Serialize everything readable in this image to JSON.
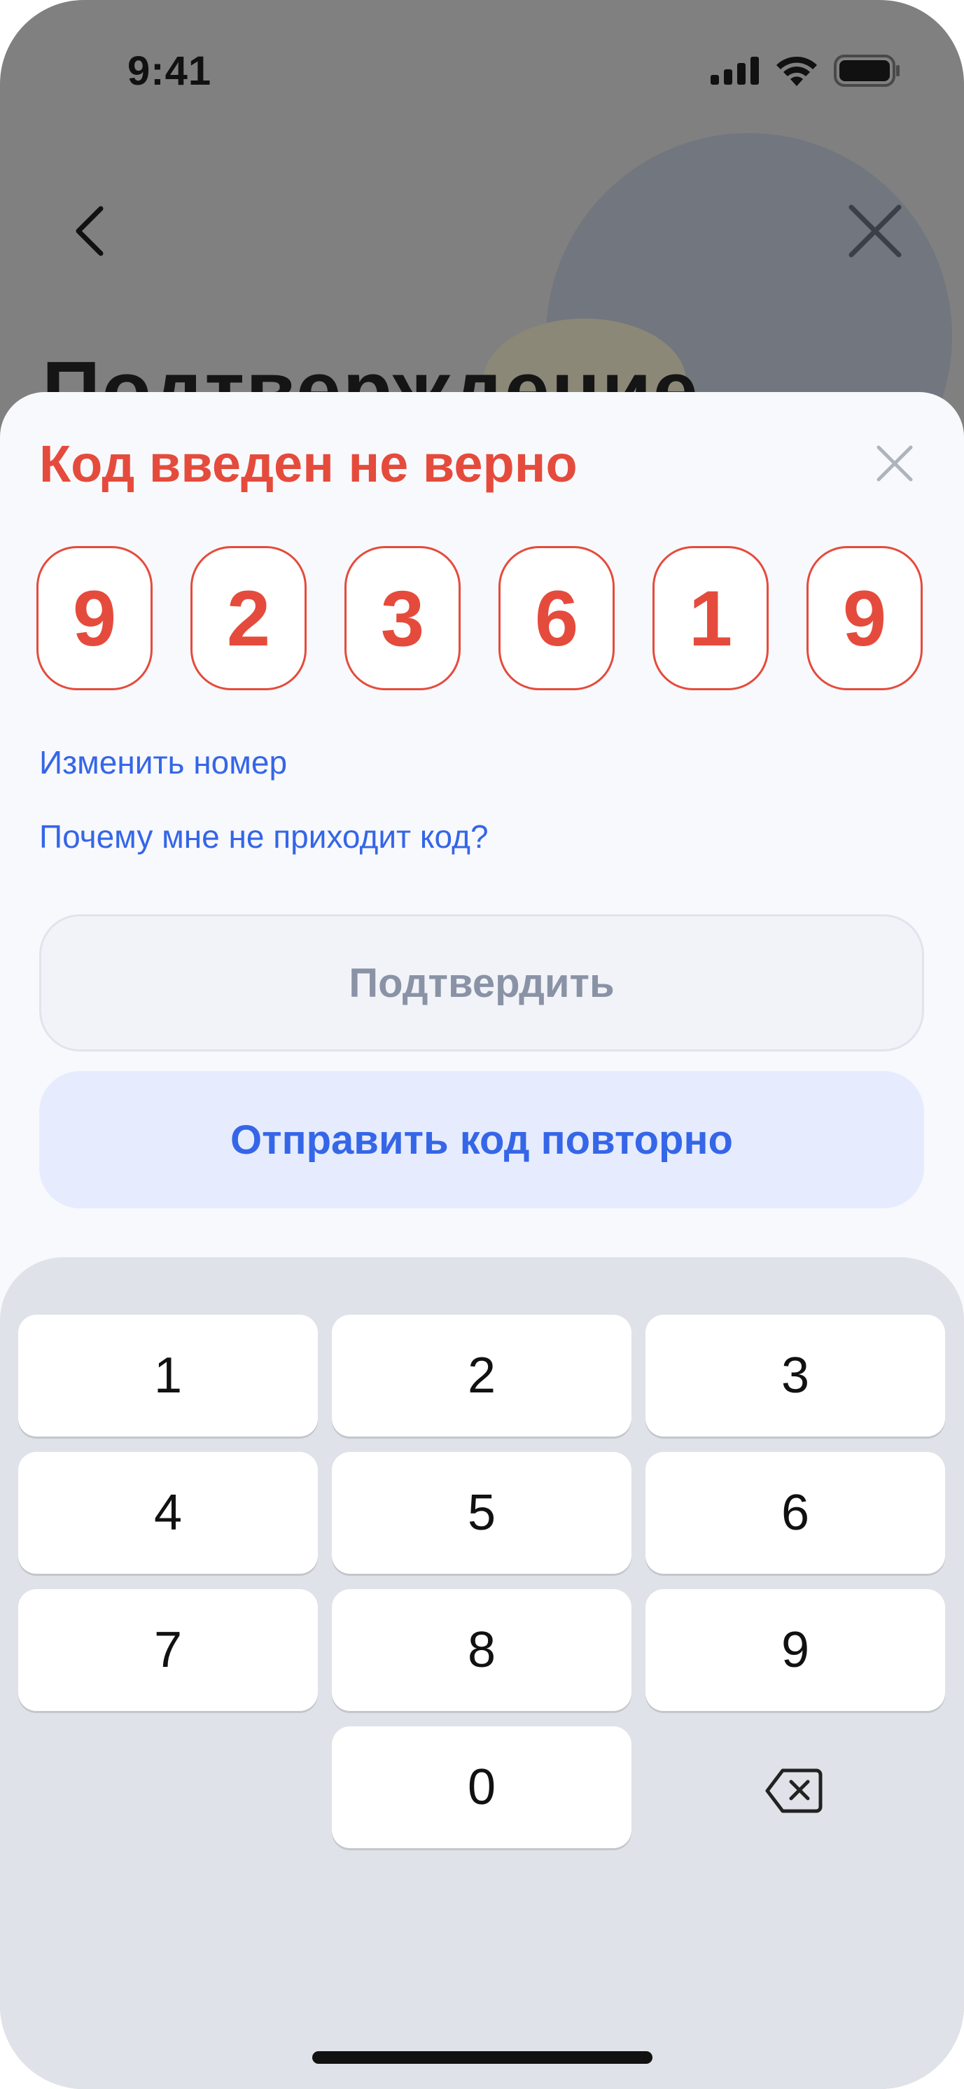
{
  "status": {
    "time": "9:41"
  },
  "background": {
    "title": "Подтверждение"
  },
  "sheet": {
    "title": "Код введен не верно",
    "code_digits": [
      "9",
      "2",
      "3",
      "6",
      "1",
      "9"
    ],
    "change_number_link": "Изменить номер",
    "why_no_code_link": "Почему мне не приходит код?",
    "confirm_button": "Подтвердить",
    "resend_button": "Отправить код повторно"
  },
  "keypad": {
    "keys": [
      "1",
      "2",
      "3",
      "4",
      "5",
      "6",
      "7",
      "8",
      "9",
      "0"
    ]
  },
  "colors": {
    "error": "#e54b3c",
    "link": "#3566e8",
    "resend_bg": "#e6ecfd",
    "keypad_bg": "#dfe2e8"
  },
  "icons": [
    "signal-icon",
    "wifi-icon",
    "battery-icon",
    "back-arrow-icon",
    "close-icon",
    "backspace-icon"
  ]
}
